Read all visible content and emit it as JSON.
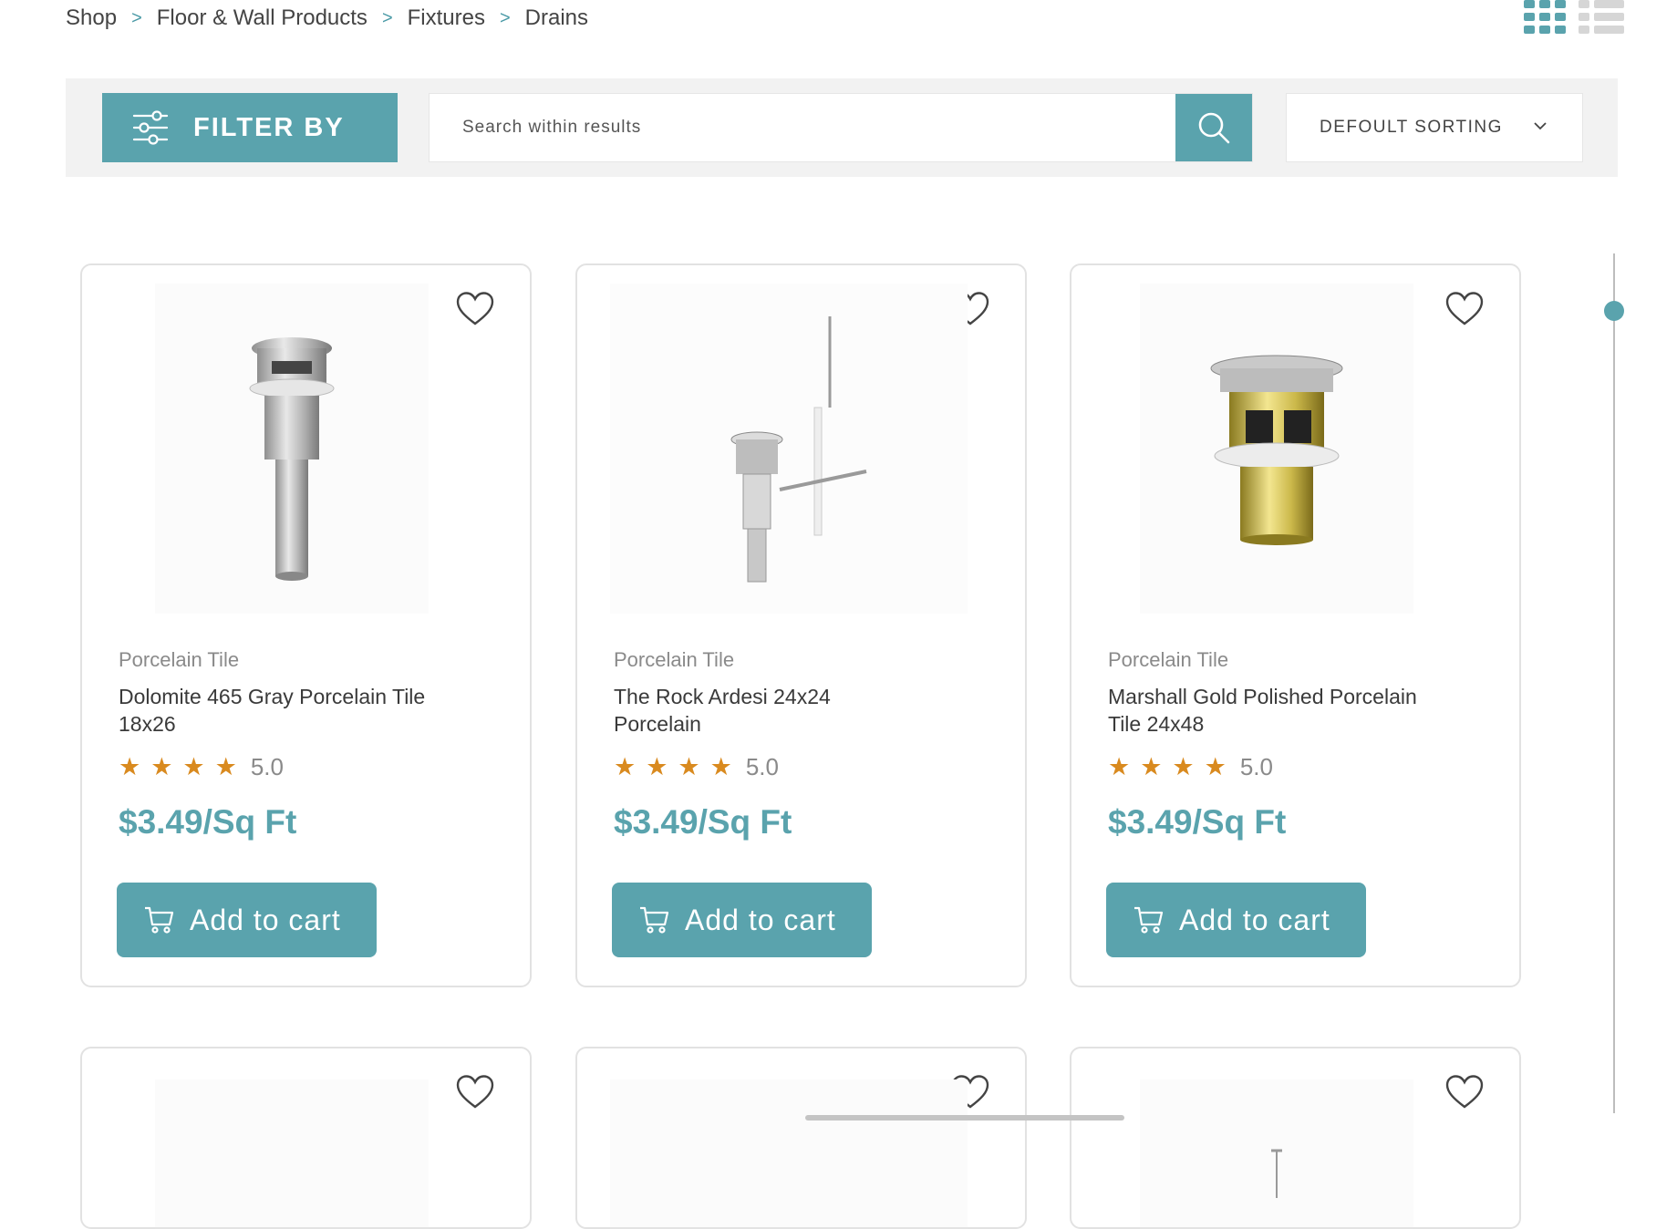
{
  "breadcrumb": [
    "Shop",
    "Floor & Wall Products",
    "Fixtures",
    "Drains"
  ],
  "toolbar": {
    "filter_label": "FILTER BY",
    "search_placeholder": "Search within results",
    "sort_label": "DEFOULT SORTING"
  },
  "products": [
    {
      "category": "Porcelain Tile",
      "title": "Dolomite 465 Gray Porcelain Tile 18x26",
      "stars": "★★★★",
      "rating": "5.0",
      "price": "$3.49/Sq Ft",
      "cart_label": "Add to cart"
    },
    {
      "category": "Porcelain Tile",
      "title": "The Rock Ardesi 24x24 Porcelain",
      "stars": "★★★★",
      "rating": "5.0",
      "price": "$3.49/Sq Ft",
      "cart_label": "Add to cart"
    },
    {
      "category": "Porcelain Tile",
      "title": "Marshall Gold Polished Porcelain Tile 24x48",
      "stars": "★★★★",
      "rating": "5.0",
      "price": "$3.49/Sq Ft",
      "cart_label": "Add to cart"
    }
  ],
  "colors": {
    "accent": "#5aa3ad",
    "star": "#d98a1f",
    "toolbar_bg": "#f2f2f2"
  },
  "icons": [
    "chevron-right-icon",
    "grid-view-icon",
    "list-view-icon",
    "filter-sliders-icon",
    "search-icon",
    "chevron-down-icon",
    "heart-icon",
    "cart-icon"
  ]
}
